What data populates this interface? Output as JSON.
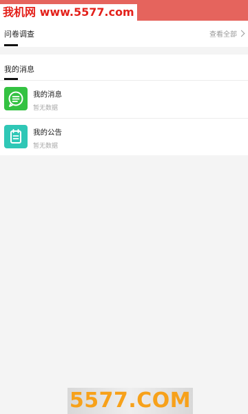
{
  "watermark_top": "我机网 www.5577.com",
  "survey": {
    "title": "问卷调查",
    "view_all": "查看全部"
  },
  "messages": {
    "title": "我的消息",
    "items": [
      {
        "title": "我的消息",
        "subtitle": "暂无数据",
        "icon": "message-icon",
        "color": "#34c242"
      },
      {
        "title": "我的公告",
        "subtitle": "暂无数据",
        "icon": "notice-icon",
        "color": "#2fc7b6"
      }
    ]
  },
  "watermark_bottom": "5577.COM",
  "colors": {
    "header": "#e5645d",
    "watermark_red": "#e3211b",
    "watermark_orange": "#f7a11a"
  }
}
